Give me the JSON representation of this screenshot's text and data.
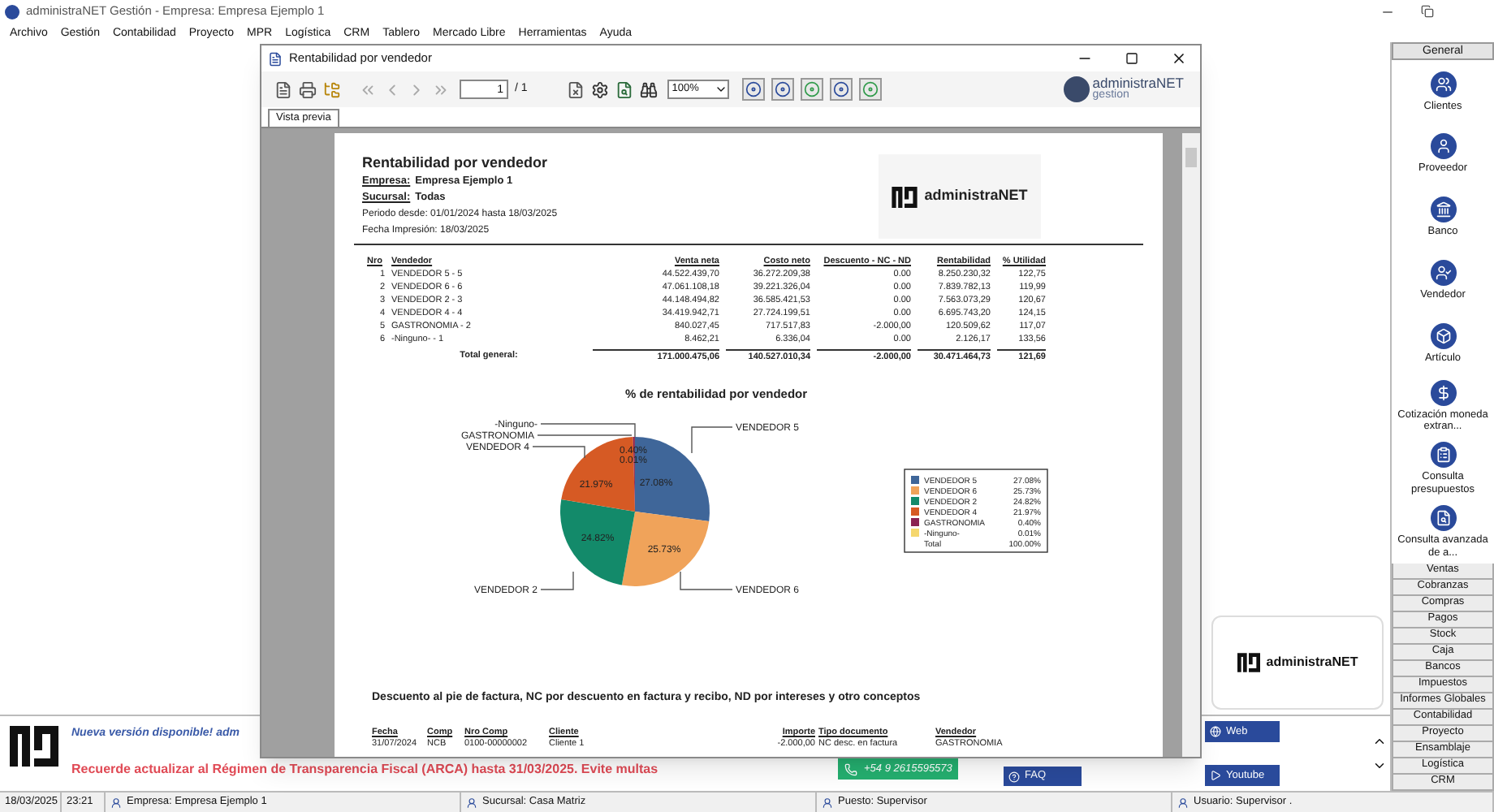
{
  "app": {
    "title": "administraNET Gestión - Empresa: Empresa Ejemplo 1"
  },
  "menu": [
    "Archivo",
    "Gestión",
    "Contabilidad",
    "Proyecto",
    "MPR",
    "Logística",
    "CRM",
    "Tablero",
    "Mercado Libre",
    "Herramientas",
    "Ayuda"
  ],
  "dialog": {
    "title": "Rentabilidad por vendedor",
    "page_field": "1",
    "page_total": "/ 1",
    "zoom": "100%",
    "logo_name": "administraNET",
    "logo_sub": "gestion",
    "tabs": [
      {
        "label": "Vista previa",
        "selected": true
      }
    ]
  },
  "report": {
    "title": "Rentabilidad por vendedor",
    "fields": [
      {
        "label": "Empresa:",
        "value": "Empresa Ejemplo 1"
      },
      {
        "label": "Sucursal:",
        "value": "Todas"
      }
    ],
    "period": "Periodo desde: 01/01/2024 hasta 18/03/2025",
    "printed": "Fecha Impresión: 18/03/2025",
    "logo": "administraNET",
    "table": {
      "columns": [
        "Nro",
        "Vendedor",
        "Venta neta",
        "Costo neto",
        "Descuento - NC - ND",
        "Rentabilidad",
        "% Utilidad"
      ],
      "rows": [
        [
          "1",
          "VENDEDOR 5 - 5",
          "44.522.439,70",
          "36.272.209,38",
          "0.00",
          "8.250.230,32",
          "122,75"
        ],
        [
          "2",
          "VENDEDOR 6 - 6",
          "47.061.108,18",
          "39.221.326,04",
          "0.00",
          "7.839.782,13",
          "119,99"
        ],
        [
          "3",
          "VENDEDOR 2 - 3",
          "44.148.494,82",
          "36.585.421,53",
          "0.00",
          "7.563.073,29",
          "120,67"
        ],
        [
          "4",
          "VENDEDOR 4 - 4",
          "34.419.942,71",
          "27.724.199,51",
          "0.00",
          "6.695.743,20",
          "124,15"
        ],
        [
          "5",
          "GASTRONOMIA - 2",
          "840.027,45",
          "717.517,83",
          "-2.000,00",
          "120.509,62",
          "117,07"
        ],
        [
          "6",
          "-Ninguno- - 1",
          "8.462,21",
          "6.336,04",
          "0.00",
          "2.126,17",
          "133,56"
        ]
      ],
      "total_label": "Total general:",
      "totals": [
        "171.000.475,06",
        "140.527.010,34",
        "-2.000,00",
        "30.471.464,73",
        "121,69"
      ]
    },
    "chart_data": {
      "type": "pie",
      "title": "% de rentabilidad por vendedor",
      "categories": [
        "VENDEDOR 5",
        "VENDEDOR 6",
        "VENDEDOR 2",
        "VENDEDOR 4",
        "GASTRONOMIA",
        "-Ninguno-"
      ],
      "values": [
        27.08,
        25.73,
        24.82,
        21.97,
        0.4,
        0.01
      ],
      "colors": [
        "#3f6699",
        "#f0a35a",
        "#138a6a",
        "#d65a24",
        "#8b2252",
        "#f5d76e"
      ],
      "data_labels": true,
      "legend": true,
      "value_labels": [
        "27.08%",
        "25.73%",
        "24.82%",
        "21.97%",
        "0.40%",
        "0.01%"
      ]
    },
    "legend_total": {
      "label": "Total",
      "value": "100.00%"
    },
    "section_title": "Descuento al pie de factura, NC por descuento en factura y recibo, ND por intereses y otro conceptos",
    "detail": {
      "columns": [
        "Fecha",
        "Comp",
        "Nro Comp",
        "Cliente",
        "Importe",
        "Tipo documento",
        "Vendedor"
      ],
      "rows": [
        [
          "31/07/2024",
          "NCB",
          "0100-00000002",
          "Cliente 1",
          "-2.000,00",
          "NC desc. en factura",
          "GASTRONOMIA"
        ]
      ]
    }
  },
  "sidebar": {
    "header": {
      "label": "General",
      "selected": true
    },
    "items": [
      "Clientes",
      "Proveedor",
      "Banco",
      "Vendedor",
      "Artículo",
      "Cotización moneda extran...",
      "Consulta presupuestos",
      "Consulta avanzada de a..."
    ],
    "sections": [
      "Ventas",
      "Cobranzas",
      "Compras",
      "Pagos",
      "Stock",
      "Caja",
      "Bancos",
      "Impuestos",
      "Informes Globales",
      "Contabilidad",
      "Proyecto",
      "Ensamblaje",
      "Logística",
      "CRM"
    ]
  },
  "logo_card": "administraNET",
  "banner": {
    "headline": "Nueva versión disponible! adm",
    "notice": "Recuerde actualizar al Régimen de Transparencia Fiscal (ARCA) hasta 31/03/2025. Evite multas",
    "whatsapp": "+54 9 2615595573",
    "web": "Web",
    "faq": "FAQ",
    "youtube": "Youtube"
  },
  "status_bar": [
    {
      "kind": "plain",
      "text": "18/03/2025"
    },
    {
      "kind": "plain",
      "text": "23:21"
    },
    {
      "kind": "user",
      "text": "Empresa: Empresa Ejemplo 1"
    },
    {
      "kind": "user",
      "text": "Sucursal: Casa Matriz"
    },
    {
      "kind": "user",
      "text": "Puesto: Supervisor"
    },
    {
      "kind": "user",
      "text": "Usuario: Supervisor ."
    }
  ]
}
